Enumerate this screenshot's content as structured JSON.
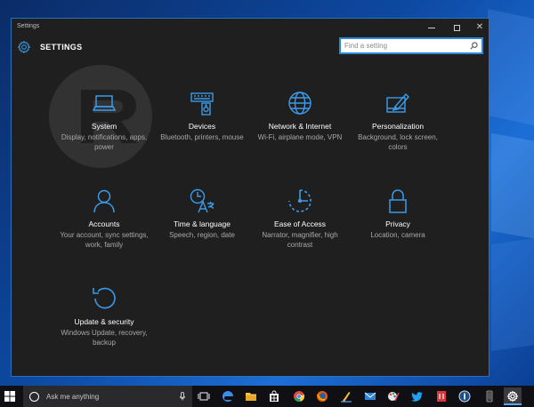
{
  "window": {
    "title": "Settings",
    "app_title": "SETTINGS",
    "search_placeholder": "Find a setting"
  },
  "tiles": [
    {
      "name": "System",
      "desc": "Display, notifications, apps, power",
      "icon": "laptop-icon"
    },
    {
      "name": "Devices",
      "desc": "Bluetooth, printers, mouse",
      "icon": "devices-icon"
    },
    {
      "name": "Network & Internet",
      "desc": "Wi-Fi, airplane mode, VPN",
      "icon": "globe-icon"
    },
    {
      "name": "Personalization",
      "desc": "Background, lock screen, colors",
      "icon": "paint-icon"
    },
    {
      "name": "Accounts",
      "desc": "Your account, sync settings, work, family",
      "icon": "person-icon"
    },
    {
      "name": "Time & language",
      "desc": "Speech, region, date",
      "icon": "time-language-icon"
    },
    {
      "name": "Ease of Access",
      "desc": "Narrator, magnifier, high contrast",
      "icon": "ease-of-access-icon"
    },
    {
      "name": "Privacy",
      "desc": "Location, camera",
      "icon": "lock-icon"
    },
    {
      "name": "Update & security",
      "desc": "Windows Update, recovery, backup",
      "icon": "update-icon"
    }
  ],
  "taskbar": {
    "search_text": "Ask me anything",
    "apps": [
      "task-view-icon",
      "edge-icon",
      "file-explorer-icon",
      "store-icon",
      "chrome-icon",
      "firefox-icon",
      "pen-app-icon",
      "mail-icon",
      "paint-app-icon",
      "twitter-icon",
      "red-app-icon",
      "password-manager-icon",
      "phone-icon",
      "settings-app-icon"
    ]
  },
  "colors": {
    "accent": "#2b88d8",
    "icon_blue": "#3a9bea",
    "window_bg": "#1f1f1f",
    "taskbar_bg": "#101014"
  }
}
